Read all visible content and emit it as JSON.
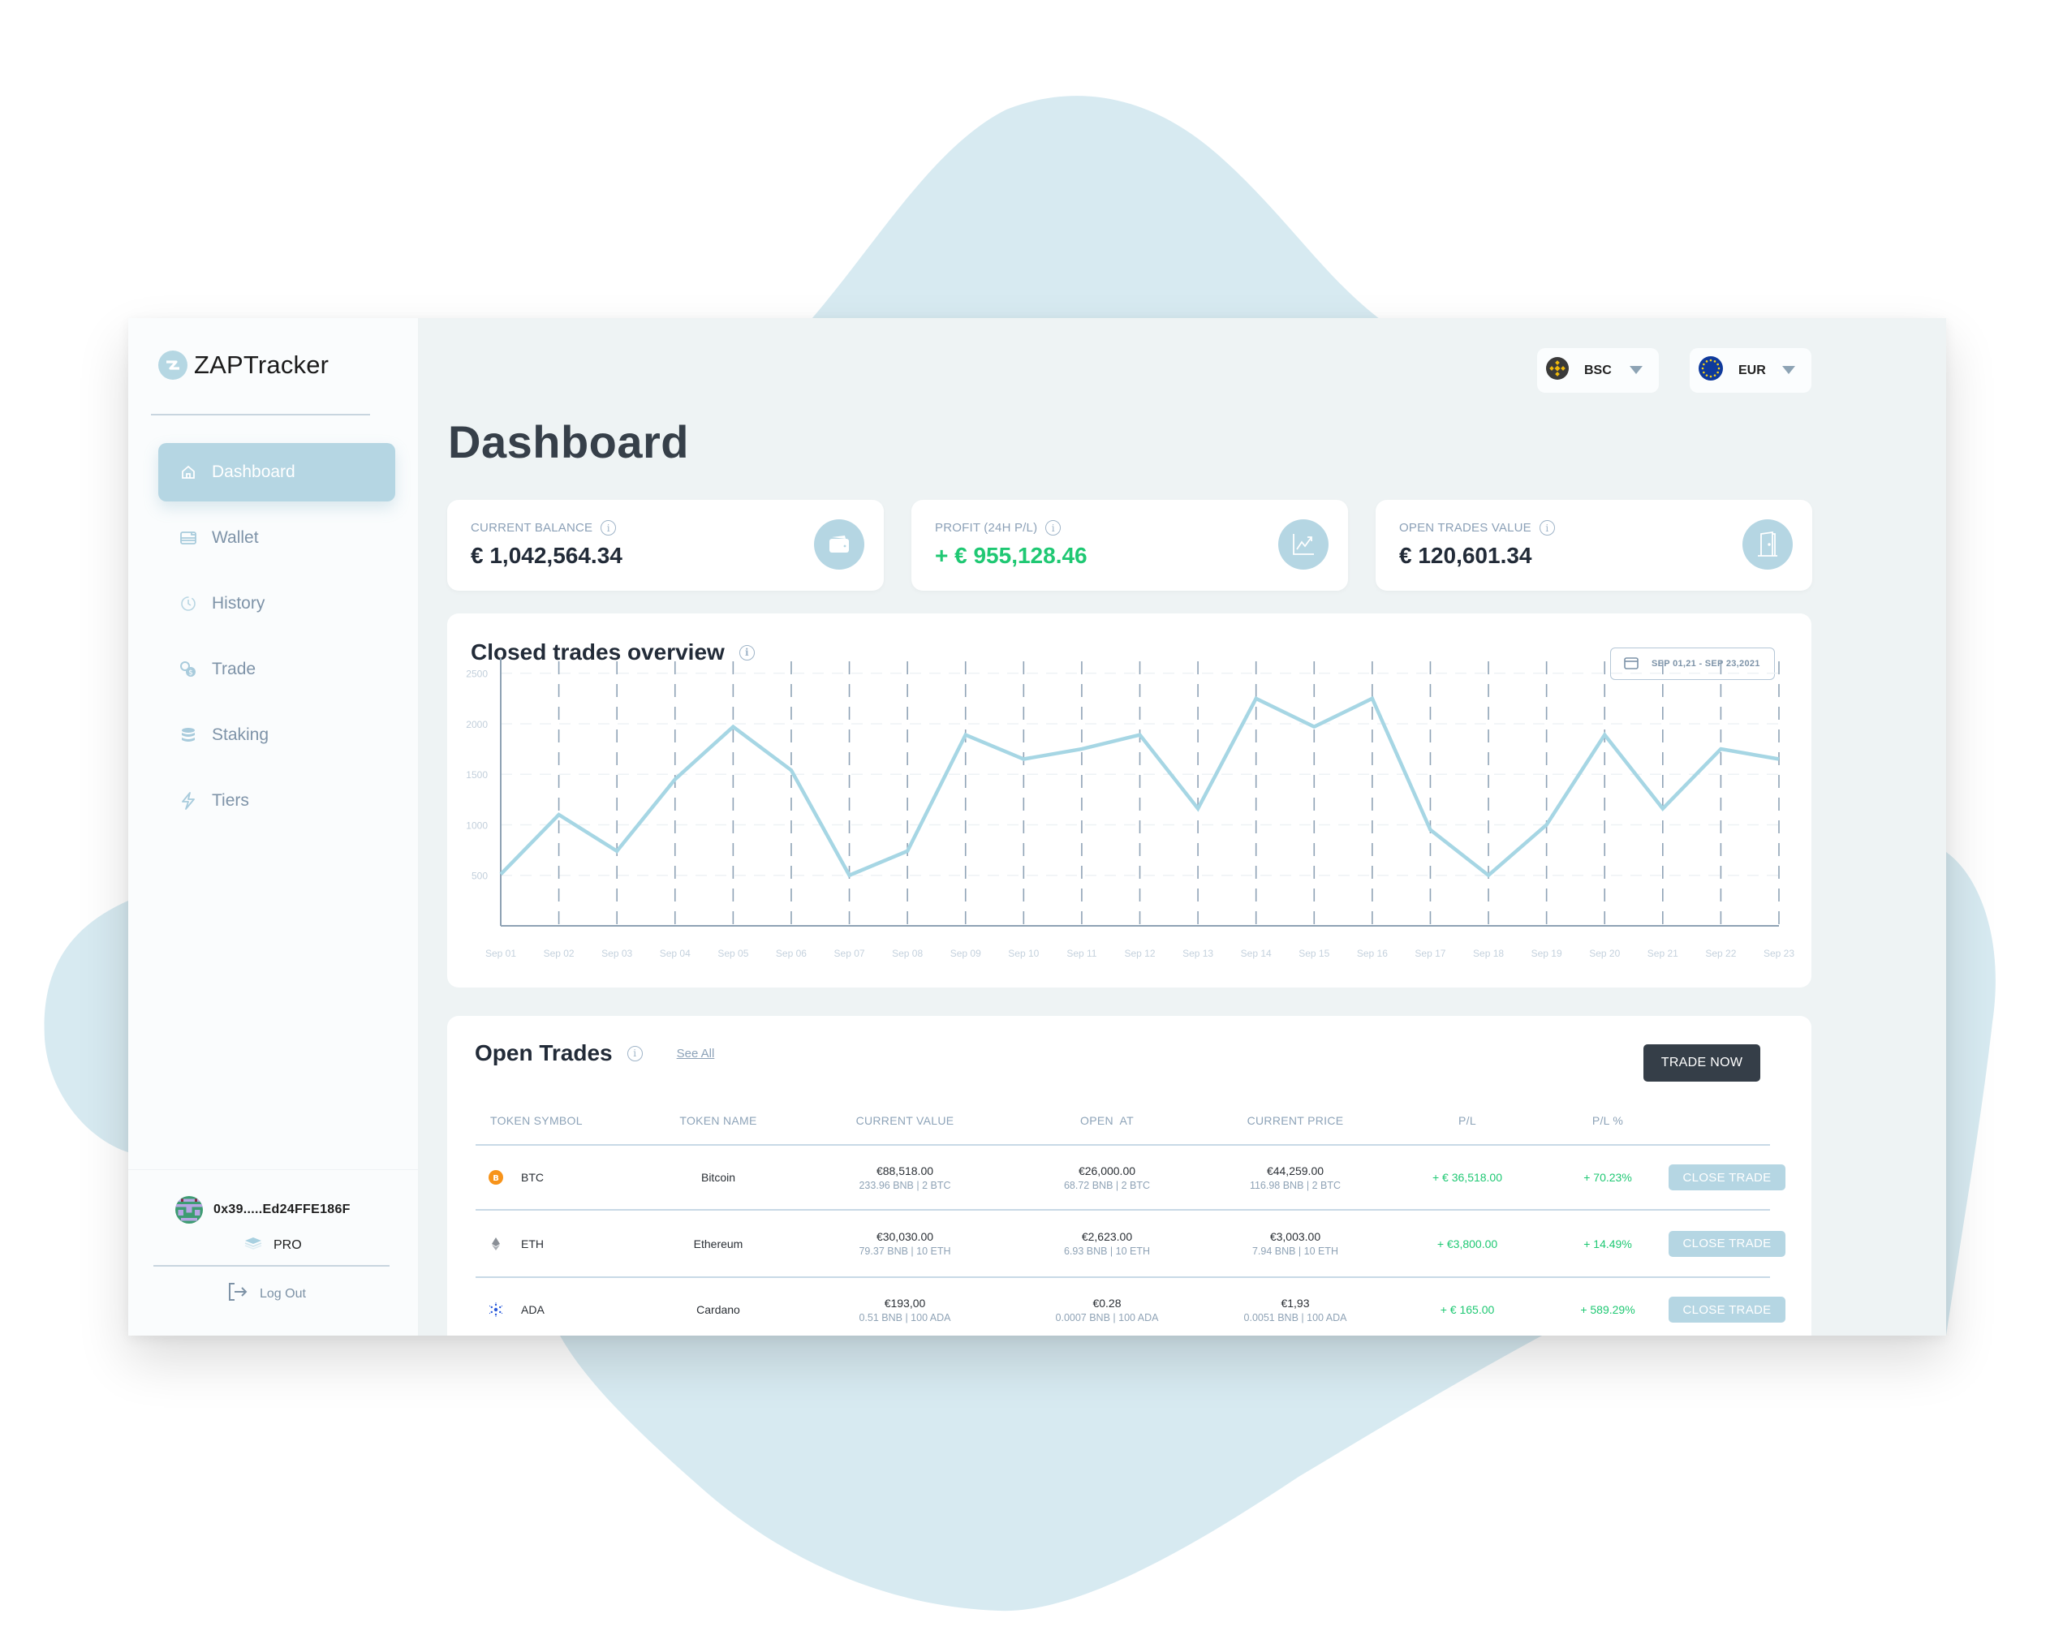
{
  "app": {
    "name": "ZAPTracker"
  },
  "sidebar": {
    "items": [
      {
        "label": "Dashboard",
        "icon": "home-icon",
        "active": true
      },
      {
        "label": "Wallet",
        "icon": "wallet-icon",
        "active": false
      },
      {
        "label": "History",
        "icon": "clock-icon",
        "active": false
      },
      {
        "label": "Trade",
        "icon": "coins-icon",
        "active": false
      },
      {
        "label": "Staking",
        "icon": "stack-icon",
        "active": false
      },
      {
        "label": "Tiers",
        "icon": "lightning-icon",
        "active": false
      }
    ],
    "account": {
      "address": "0x39.....Ed24FFE186F",
      "tier": "PRO",
      "logout_label": "Log Out"
    }
  },
  "header": {
    "title": "Dashboard",
    "chain_selector": {
      "value": "BSC",
      "icon": "binance-icon"
    },
    "currency_selector": {
      "value": "EUR",
      "icon": "eu-flag-icon"
    }
  },
  "stats": [
    {
      "label": "CURRENT BALANCE",
      "value": "€ 1,042,564.34",
      "positive": false,
      "icon": "wallet-icon"
    },
    {
      "label": "PROFIT (24H P/L)",
      "value": "+ € 955,128.46",
      "positive": true,
      "icon": "trending-up-icon"
    },
    {
      "label": "OPEN TRADES VALUE",
      "value": "€ 120,601.34",
      "positive": false,
      "icon": "door-icon"
    }
  ],
  "colors": {
    "accent": "#b5d6e3",
    "line": "#a6d6e4",
    "positive": "#1fc873",
    "dark_button": "#353e48",
    "background_blob": "#d7eaf1"
  },
  "chart_data": {
    "type": "line",
    "title": "Closed trades overview",
    "date_range": "SEP 01,21 - SEP 23,2021",
    "xlabel": "",
    "ylabel": "",
    "x": [
      "Sep 01",
      "Sep 02",
      "Sep 03",
      "Sep 04",
      "Sep 05",
      "Sep 06",
      "Sep 07",
      "Sep 08",
      "Sep 09",
      "Sep 10",
      "Sep 11",
      "Sep 12",
      "Sep 13",
      "Sep 14",
      "Sep 15",
      "Sep 16",
      "Sep 17",
      "Sep 18",
      "Sep 19",
      "Sep 20",
      "Sep 21",
      "Sep 22",
      "Sep 23"
    ],
    "series": [
      {
        "name": "Closed trades",
        "values": [
          510,
          1100,
          740,
          1450,
          1970,
          1540,
          500,
          740,
          1890,
          1650,
          1750,
          1890,
          1160,
          2250,
          1970,
          2250,
          950,
          500,
          1000,
          1890,
          1160,
          1750,
          1650
        ]
      }
    ],
    "yticks": [
      500,
      1000,
      1500,
      2000,
      2500
    ],
    "ylim": [
      0,
      2650
    ],
    "grid": "vertical dashed per date, faint horizontal per tick",
    "legend": "none"
  },
  "open_trades": {
    "title": "Open Trades",
    "see_all_label": "See All",
    "trade_now_label": "TRADE NOW",
    "columns": [
      "TOKEN SYMBOL",
      "TOKEN NAME",
      "CURRENT VALUE",
      "OPEN  AT",
      "CURRENT PRICE",
      "P/L",
      "P/L %"
    ],
    "rows": [
      {
        "symbol": "BTC",
        "icon": "bitcoin-icon",
        "name": "Bitcoin",
        "current_value": "€88,518.00",
        "current_value_sub": "233.96 BNB | 2 BTC",
        "open_at": "€26,000.00",
        "open_at_sub": "68.72 BNB | 2 BTC",
        "current_price": "€44,259.00",
        "current_price_sub": "116.98 BNB | 2 BTC",
        "pl": "+ € 36,518.00",
        "pl_pct": "+ 70.23%",
        "action": "CLOSE TRADE"
      },
      {
        "symbol": "ETH",
        "icon": "ethereum-icon",
        "name": "Ethereum",
        "current_value": "€30,030.00",
        "current_value_sub": "79.37 BNB | 10 ETH",
        "open_at": "€2,623.00",
        "open_at_sub": "6.93 BNB | 10 ETH",
        "current_price": "€3,003.00",
        "current_price_sub": "7.94 BNB | 10 ETH",
        "pl": "+ €3,800.00",
        "pl_pct": "+ 14.49%",
        "action": "CLOSE TRADE"
      },
      {
        "symbol": "ADA",
        "icon": "cardano-icon",
        "name": "Cardano",
        "current_value": "€193,00",
        "current_value_sub": "0.51 BNB | 100 ADA",
        "open_at": "€0.28",
        "open_at_sub": "0.0007 BNB | 100 ADA",
        "current_price": "€1,93",
        "current_price_sub": "0.0051 BNB | 100 ADA",
        "pl": "+ € 165.00",
        "pl_pct": "+ 589.29%",
        "action": "CLOSE TRADE"
      }
    ]
  }
}
